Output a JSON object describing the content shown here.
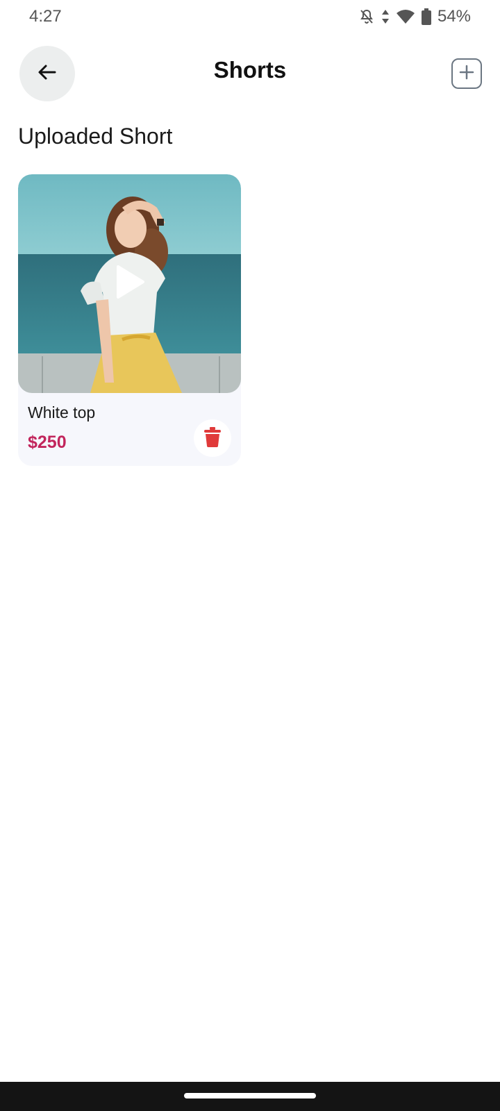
{
  "status_bar": {
    "time": "4:27",
    "battery": "54%",
    "icons": [
      "bell-off-icon",
      "data-arrows-icon",
      "wifi-icon",
      "battery-icon"
    ]
  },
  "header": {
    "title": "Shorts",
    "back_icon": "arrow-left-icon",
    "add_icon": "plus-square-icon"
  },
  "section": {
    "title": "Uploaded Short"
  },
  "shorts": [
    {
      "name": "White top",
      "price": "$250",
      "thumbnail": "video-thumbnail",
      "play_icon": "play-icon",
      "delete_icon": "trash-icon"
    }
  ],
  "colors": {
    "price": "#c2255c",
    "delete": "#e03a3a",
    "card_bg": "#f6f7fc"
  }
}
